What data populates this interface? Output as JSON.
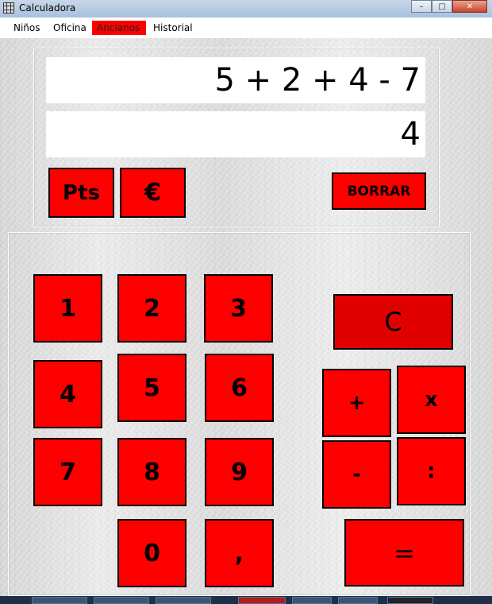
{
  "window": {
    "title": "Calculadora",
    "controls": {
      "minimize": "–",
      "maximize": "□",
      "close": "✕"
    }
  },
  "menu": [
    "Niños",
    "Oficina",
    "Ancianos",
    "Historial"
  ],
  "display": {
    "expression": "5 + 2 + 4 - 7",
    "result": "4"
  },
  "top_buttons": {
    "pts": "Pts",
    "euro": "€",
    "borrar": "BORRAR"
  },
  "keys": {
    "k1": "1",
    "k2": "2",
    "k3": "3",
    "k4": "4",
    "k5": "5",
    "k6": "6",
    "k7": "7",
    "k8": "8",
    "k9": "9",
    "k0": "0",
    "comma": ",",
    "clear": "C",
    "plus": "+",
    "times": "x",
    "minus": "-",
    "divide": ":",
    "equals": "="
  },
  "colors": {
    "button_red": "#ff0000",
    "clear_red": "#e00000",
    "active_menu": "#ff0000"
  }
}
